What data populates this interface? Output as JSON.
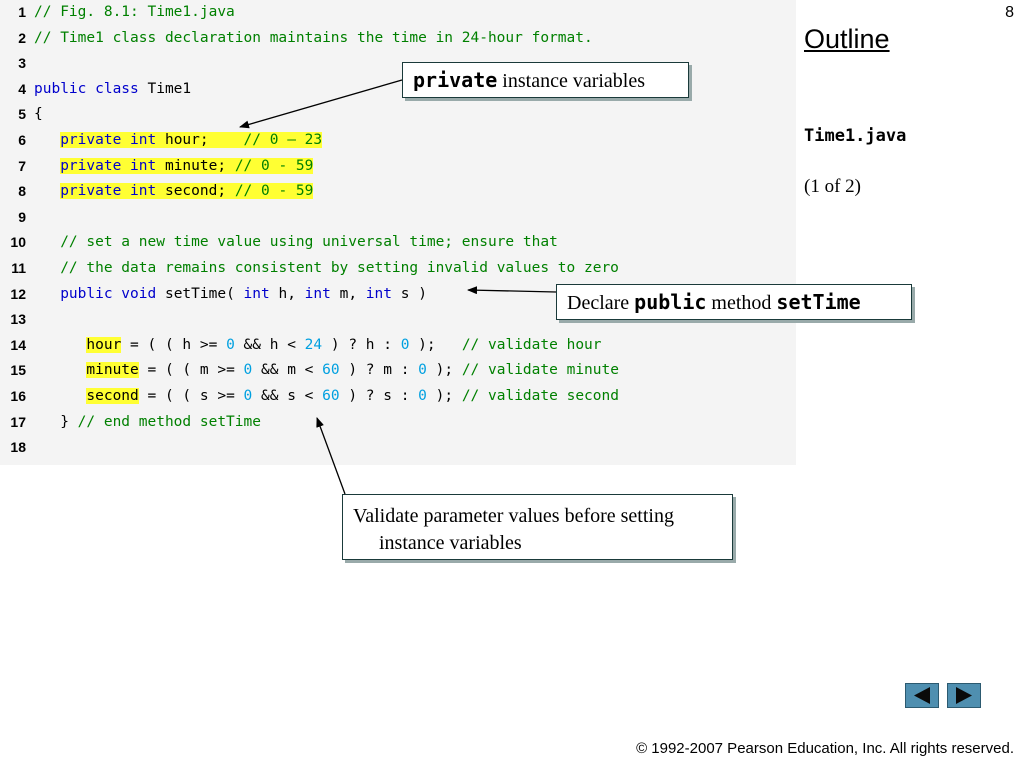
{
  "slide": {
    "page_number": "8",
    "outline_label": "Outline",
    "file_name": "Time1.java",
    "part_label": "(1 of 2)",
    "copyright": "© 1992-2007 Pearson Education, Inc.  All rights reserved."
  },
  "code": {
    "lines": [
      {
        "n": "1",
        "segs": [
          {
            "t": "// Fig. 8.1: Time1.java",
            "c": "cm"
          }
        ]
      },
      {
        "n": "2",
        "segs": [
          {
            "t": "// Time1 class declaration maintains the time in 24-hour format.",
            "c": "cm"
          }
        ]
      },
      {
        "n": "3",
        "segs": []
      },
      {
        "n": "4",
        "segs": [
          {
            "t": "public class",
            "c": "kw"
          },
          {
            "t": " Time1"
          }
        ]
      },
      {
        "n": "5",
        "segs": [
          {
            "t": "{"
          }
        ]
      },
      {
        "n": "6",
        "segs": [
          {
            "t": "   "
          },
          {
            "t": "private int",
            "c": "kw hl"
          },
          {
            "t": " hour;    ",
            "c": "hl"
          },
          {
            "t": "// 0 – 23",
            "c": "cm hl"
          }
        ]
      },
      {
        "n": "7",
        "segs": [
          {
            "t": "   "
          },
          {
            "t": "private int",
            "c": "kw hl"
          },
          {
            "t": " minute; ",
            "c": "hl"
          },
          {
            "t": "// 0 - 59",
            "c": "cm hl"
          }
        ]
      },
      {
        "n": "8",
        "segs": [
          {
            "t": "   "
          },
          {
            "t": "private int",
            "c": "kw hl"
          },
          {
            "t": " second; ",
            "c": "hl"
          },
          {
            "t": "// 0 - 59",
            "c": "cm hl"
          }
        ]
      },
      {
        "n": "9",
        "segs": []
      },
      {
        "n": "10",
        "segs": [
          {
            "t": "   "
          },
          {
            "t": "// set a new time value using universal time; ensure that",
            "c": "cm"
          }
        ]
      },
      {
        "n": "11",
        "segs": [
          {
            "t": "   "
          },
          {
            "t": "// the data remains consistent by setting invalid values to zero",
            "c": "cm"
          }
        ]
      },
      {
        "n": "12",
        "segs": [
          {
            "t": "   "
          },
          {
            "t": "public void",
            "c": "kw"
          },
          {
            "t": " setTime( "
          },
          {
            "t": "int",
            "c": "kw"
          },
          {
            "t": " h, "
          },
          {
            "t": "int",
            "c": "kw"
          },
          {
            "t": " m, "
          },
          {
            "t": "int",
            "c": "kw"
          },
          {
            "t": " s )"
          }
        ]
      },
      {
        "n": "13",
        "segs": []
      },
      {
        "n": "14",
        "segs": [
          {
            "t": "      "
          },
          {
            "t": "hour",
            "c": "hl"
          },
          {
            "t": " = ( ( h >= "
          },
          {
            "t": "0",
            "c": "num"
          },
          {
            "t": " && h < "
          },
          {
            "t": "24",
            "c": "num"
          },
          {
            "t": " ) ? h : "
          },
          {
            "t": "0",
            "c": "num"
          },
          {
            "t": " );   "
          },
          {
            "t": "// validate hour",
            "c": "cm"
          }
        ]
      },
      {
        "n": "15",
        "segs": [
          {
            "t": "      "
          },
          {
            "t": "minute",
            "c": "hl"
          },
          {
            "t": " = ( ( m >= "
          },
          {
            "t": "0",
            "c": "num"
          },
          {
            "t": " && m < "
          },
          {
            "t": "60",
            "c": "num"
          },
          {
            "t": " ) ? m : "
          },
          {
            "t": "0",
            "c": "num"
          },
          {
            "t": " ); "
          },
          {
            "t": "// validate minute",
            "c": "cm"
          }
        ]
      },
      {
        "n": "16",
        "segs": [
          {
            "t": "      "
          },
          {
            "t": "second",
            "c": "hl"
          },
          {
            "t": " = ( ( s >= "
          },
          {
            "t": "0",
            "c": "num"
          },
          {
            "t": " && s < "
          },
          {
            "t": "60",
            "c": "num"
          },
          {
            "t": " ) ? s : "
          },
          {
            "t": "0",
            "c": "num"
          },
          {
            "t": " ); "
          },
          {
            "t": "// validate second",
            "c": "cm"
          }
        ]
      },
      {
        "n": "17",
        "segs": [
          {
            "t": "   } "
          },
          {
            "t": "// end method setTime",
            "c": "cm"
          }
        ]
      },
      {
        "n": "18",
        "segs": []
      }
    ]
  },
  "callouts": {
    "private_vars": {
      "code": "private",
      "text": " instance variables"
    },
    "settime": {
      "pre": "Declare ",
      "code1": "public",
      "mid": " method ",
      "code2": "setTime"
    },
    "validate": {
      "line1": "Validate parameter values before setting",
      "line2": "instance variables"
    }
  },
  "colors": {
    "keyword": "#0000cc",
    "comment": "#008000",
    "number": "#00a0e0",
    "highlight": "#ffff33",
    "nav_button": "#4f8fb0"
  },
  "icons": {
    "prev": "triangle-left-icon",
    "next": "triangle-right-icon"
  }
}
